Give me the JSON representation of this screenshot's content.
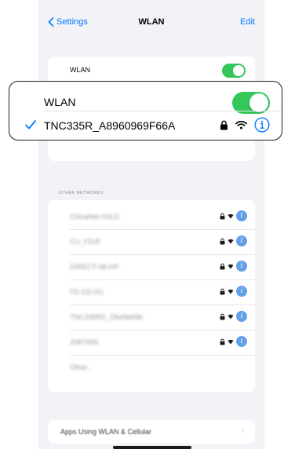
{
  "nav": {
    "back_label": "Settings",
    "title": "WLAN",
    "edit_label": "Edit"
  },
  "wlan_toggle": {
    "label": "WLAN",
    "on": true
  },
  "connected": {
    "ssid": "TNC335R_A8960969F66A"
  },
  "other_networks": {
    "header": "OTHER NETWORKS",
    "items": [
      {
        "label": "ChinaNet-X4LD"
      },
      {
        "label": "CU_FDJF"
      },
      {
        "label": "DIRECT-0B-HP"
      },
      {
        "label": "FD-CD-0G"
      },
      {
        "label": "TNC335RC_D6e8e69b"
      },
      {
        "label": "J0B7A55"
      }
    ],
    "other_label": "Other..."
  },
  "footer": {
    "apps_label": "Apps Using WLAN & Cellular"
  },
  "colors": {
    "accent": "#007aff",
    "toggle_on": "#34c759",
    "background": "#f2f2f7"
  }
}
